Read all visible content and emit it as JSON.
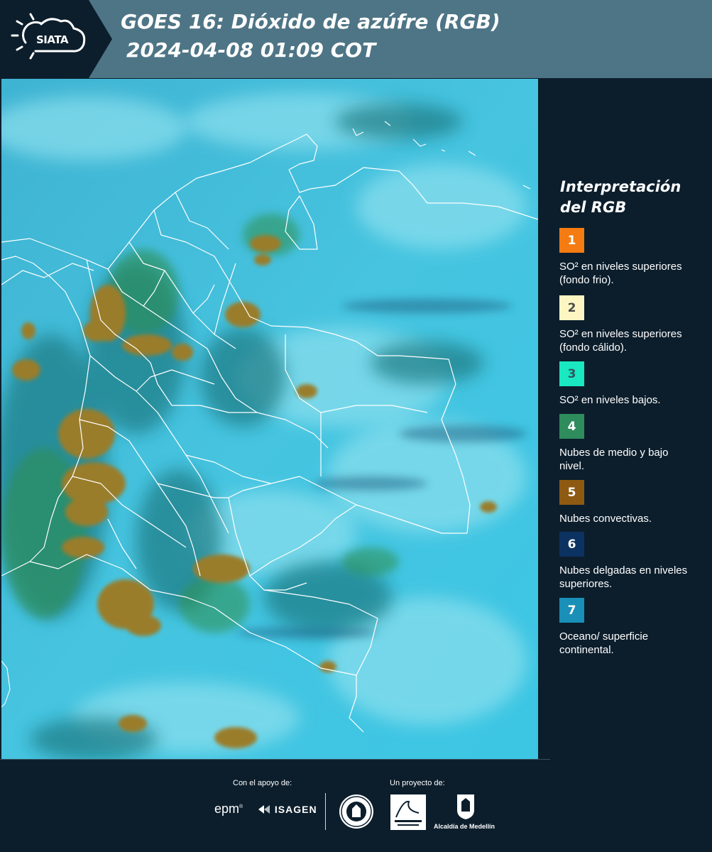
{
  "header": {
    "logo_text": "SIATA",
    "title_line1": "GOES 16: Dióxido de azúfre (RGB)",
    "title_line2": "2024-04-08 01:09 COT"
  },
  "legend": {
    "title_line1": "Interpretación",
    "title_line2": "del RGB",
    "items": [
      {
        "number": "1",
        "color": "#f57c12",
        "text_color": "#ffffff",
        "label": "SO² en niveles superiores (fondo frio)."
      },
      {
        "number": "2",
        "color": "#fdf6c3",
        "text_color": "#4a4a4a",
        "label": "SO² en niveles superiores (fondo cálido)."
      },
      {
        "number": "3",
        "color": "#19e8c0",
        "text_color": "#2f5560",
        "label": "SO² en niveles bajos."
      },
      {
        "number": "4",
        "color": "#2f8c5c",
        "text_color": "#ffffff",
        "label": "Nubes de medio y bajo nivel."
      },
      {
        "number": "5",
        "color": "#8e5a12",
        "text_color": "#ffffff",
        "label": "Nubes convectivas."
      },
      {
        "number": "6",
        "color": "#0c3262",
        "text_color": "#ffffff",
        "label": "Nubes delgadas en niveles superiores."
      },
      {
        "number": "7",
        "color": "#1a90b8",
        "text_color": "#ffffff",
        "label": "Oceano/ superficie continental."
      }
    ]
  },
  "footer": {
    "support_label": "Con el apoyo de:",
    "project_label": "Un proyecto de:",
    "epm": "epm",
    "isagen": "ISAGEN",
    "alcaldia": "Alcaldía de Medellín"
  }
}
